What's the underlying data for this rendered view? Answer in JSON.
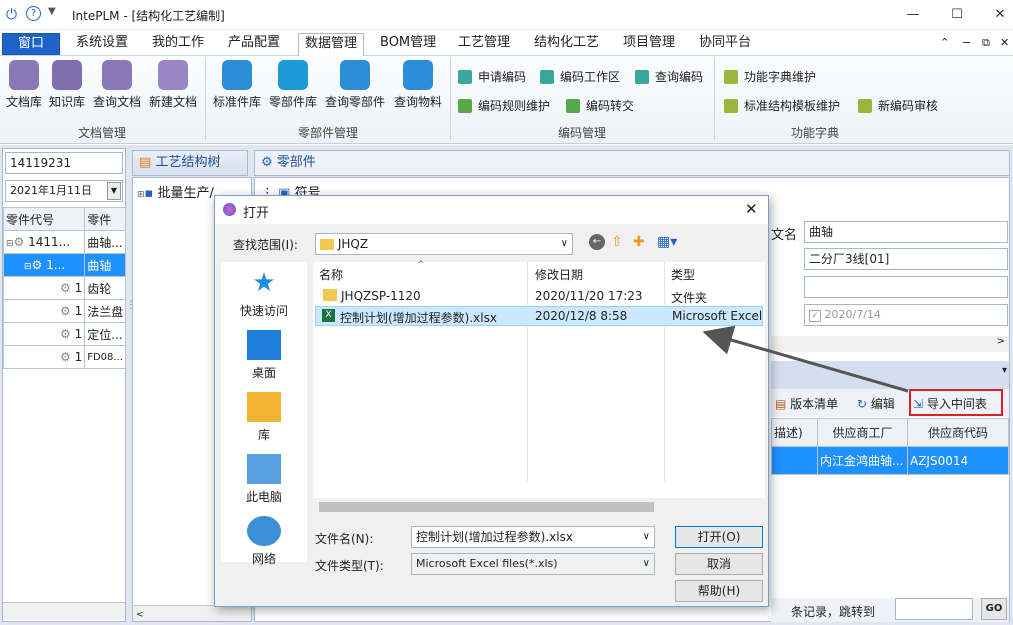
{
  "app": {
    "title": "IntePLM - [结构化工艺编制]"
  },
  "menu": [
    "窗口",
    "系统设置",
    "我的工作",
    "产品配置",
    "数据管理",
    "BOM管理",
    "工艺管理",
    "结构化工艺",
    "项目管理",
    "协同平台"
  ],
  "ribbon": {
    "doc_group": {
      "label": "文档管理",
      "items": [
        "文档库",
        "知识库",
        "查询文档",
        "新建文档"
      ]
    },
    "part_group": {
      "label": "零部件管理",
      "items": [
        "标准件库",
        "零部件库",
        "查询零部件",
        "查询物料"
      ]
    },
    "code_group": {
      "label": "编码管理",
      "items": [
        "申请编码",
        "编码工作区",
        "查询编码",
        "编码规则维护",
        "编码转交"
      ]
    },
    "dict_group": {
      "label": "功能字典",
      "items": [
        "功能字典维护",
        "标准结构模板维护",
        "新编码审核"
      ]
    }
  },
  "left": {
    "search_value": "14119231",
    "date_value": "2021年1月11日",
    "col1": "零件代号",
    "col2": "零件",
    "rows": [
      {
        "code": "1411...",
        "name": "曲轴..."
      },
      {
        "code": "1...",
        "name": "曲轴"
      },
      {
        "code": "1",
        "name": "齿轮"
      },
      {
        "code": "1",
        "name": "法兰盘"
      },
      {
        "code": "1",
        "name": "定位..."
      },
      {
        "code": "1",
        "name": "FD08..."
      }
    ]
  },
  "tabs": {
    "process_tree": "工艺结构树",
    "parts": "零部件"
  },
  "tree": {
    "root": "批量生产/..."
  },
  "right": {
    "symbol_label": "符号",
    "name_label": "文名",
    "name_value": "曲轴",
    "line_value": "二分厂3线[01]",
    "date_value": "2020/7/14",
    "toolbar": {
      "version_list": "版本清单",
      "edit": "编辑",
      "import_mid": "导入中间表"
    },
    "cols": [
      "描述)",
      "供应商工厂",
      "供应商代码"
    ],
    "row": [
      "",
      "内江金鸿曲轴...",
      "AZJS0014"
    ],
    "footer": {
      "records_text": "条记录，跳转到",
      "go": "GO"
    }
  },
  "dialog": {
    "title": "打开",
    "lookin_label": "查找范围(I):",
    "lookin_value": "JHQZ",
    "places": [
      "快速访问",
      "桌面",
      "库",
      "此电脑",
      "网络"
    ],
    "columns": {
      "name": "名称",
      "date": "修改日期",
      "type": "类型"
    },
    "files": [
      {
        "name": "JHQZSP-1120",
        "date": "2020/11/20 17:23",
        "type": "文件夹"
      },
      {
        "name": "控制计划(增加过程参数).xlsx",
        "date": "2020/12/8 8:58",
        "type": "Microsoft Excel"
      }
    ],
    "filename_label": "文件名(N):",
    "filename_value": "控制计划(增加过程参数).xlsx",
    "filetype_label": "文件类型(T):",
    "filetype_value": "Microsoft Excel files(*.xls)",
    "open_btn": "打开(O)",
    "cancel_btn": "取消",
    "help_btn": "帮助(H)"
  },
  "colors": {
    "accent": "#1e64c8",
    "selection": "#1e90ff",
    "highlight": "#e02020"
  }
}
